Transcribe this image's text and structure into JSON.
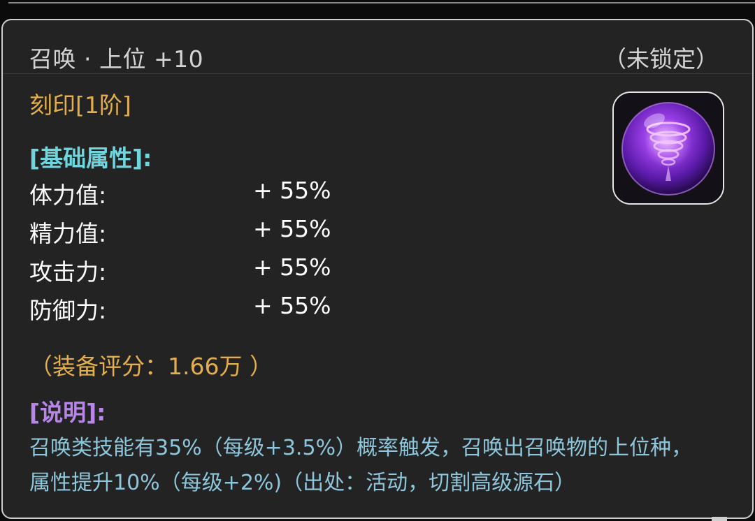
{
  "item": {
    "title": "召唤 · 上位 +10",
    "lock_status": "（未锁定）",
    "engrave": "刻印[1阶]",
    "icon": "purple-tornado-orb-icon"
  },
  "base_stats": {
    "header": "[基础属性]:",
    "rows": [
      {
        "name": "体力值:",
        "value": "+ 55%"
      },
      {
        "name": "精力值:",
        "value": "+ 55%"
      },
      {
        "name": "攻击力:",
        "value": "+ 55%"
      },
      {
        "name": "防御力:",
        "value": "+ 55%"
      }
    ]
  },
  "score": "（装备评分：1.66万 ）",
  "description": {
    "header": "[说明]:",
    "lines": [
      "召唤类技能有35%（每级+3.5%）概率触发，召唤出召唤物的上位种，",
      "属性提升10%（每级+2%)（出处：活动，切割高级源石）"
    ]
  },
  "colors": {
    "panel_bg": "#232323",
    "gold": "#e2ae4e",
    "cyan": "#6fd6dd",
    "purple": "#b886e8",
    "desc_blue": "#8ec6db"
  }
}
